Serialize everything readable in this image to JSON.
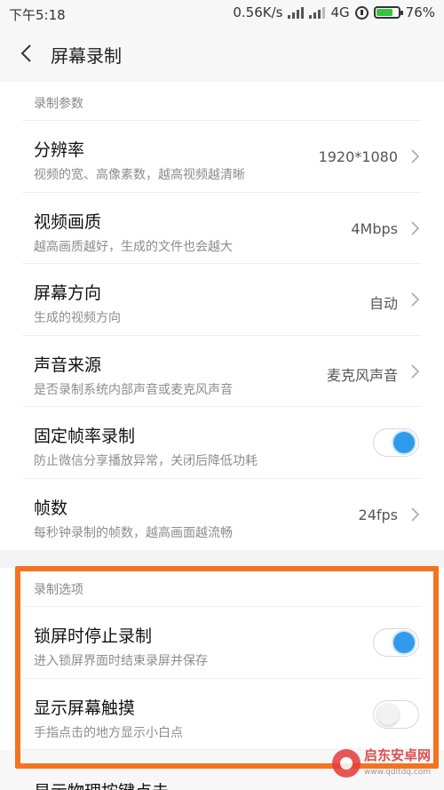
{
  "status_bar": {
    "time": "下午5:18",
    "speed": "0.56K/s",
    "network": "4G",
    "battery": "76%",
    "battery_level": 0.76
  },
  "header": {
    "title": "屏幕录制"
  },
  "sections": [
    {
      "label": "录制参数",
      "rows": [
        {
          "title": "分辨率",
          "subtitle": "视频的宽、高像素数，越高视频越清晰",
          "value": "1920*1080"
        },
        {
          "title": "视频画质",
          "subtitle": "越高画质越好，生成的文件也会越大",
          "value": "4Mbps"
        },
        {
          "title": "屏幕方向",
          "subtitle": "生成的视频方向",
          "value": "自动"
        },
        {
          "title": "声音来源",
          "subtitle": "是否录制系统内部声音或麦克风声音",
          "value": "麦克风声音"
        },
        {
          "title": "固定帧率录制",
          "subtitle": "防止微信分享播放异常，关闭后降低功耗",
          "toggle": true
        },
        {
          "title": "帧数",
          "subtitle": "每秒钟录制的帧数，越高画面越流畅",
          "value": "24fps"
        }
      ]
    },
    {
      "label": "录制选项",
      "rows": [
        {
          "title": "锁屏时停止录制",
          "subtitle": "进入锁屏界面时结束录屏并保存",
          "toggle": true
        },
        {
          "title": "显示屏幕触摸",
          "subtitle": "手指点击的地方显示小白点",
          "toggle": false
        }
      ]
    }
  ],
  "partial_row": {
    "title": "显示物理按键点击"
  },
  "watermark": {
    "name": "启东安卓网",
    "url": "www.qdltdq.com"
  },
  "colors": {
    "accent": "#2f9bea",
    "highlight": "#f57320"
  }
}
